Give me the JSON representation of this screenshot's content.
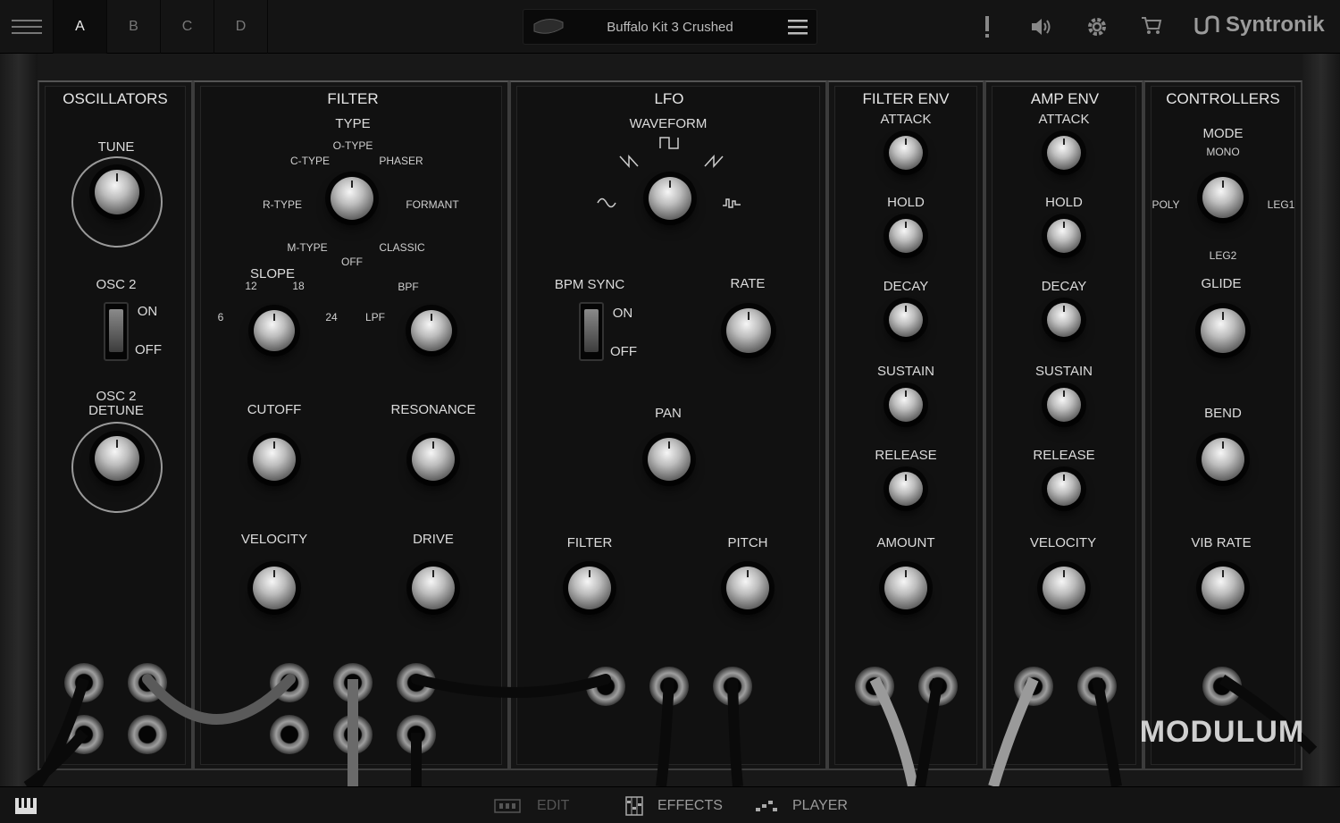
{
  "topbar": {
    "banks": [
      "A",
      "B",
      "C",
      "D"
    ],
    "active_bank": "A",
    "preset_name": "Buffalo Kit 3 Crushed",
    "brand": "Syntronik"
  },
  "oscillators": {
    "title": "OSCILLATORS",
    "tune_label": "TUNE",
    "osc2_label": "OSC 2",
    "on": "ON",
    "off": "OFF",
    "detune_label_1": "OSC 2",
    "detune_label_2": "DETUNE"
  },
  "filter": {
    "title": "FILTER",
    "type_label": "TYPE",
    "types": {
      "o": "O-TYPE",
      "c": "C-TYPE",
      "phaser": "PHASER",
      "r": "R-TYPE",
      "formant": "FORMANT",
      "m": "M-TYPE",
      "classic": "CLASSIC",
      "off": "OFF"
    },
    "slope_label": "SLOPE",
    "slopes": {
      "s6": "6",
      "s12": "12",
      "s18": "18",
      "s24": "24"
    },
    "mode": {
      "bpf": "BPF",
      "lpf": "LPF"
    },
    "cutoff": "CUTOFF",
    "resonance": "RESONANCE",
    "velocity": "VELOCITY",
    "drive": "DRIVE"
  },
  "lfo": {
    "title": "LFO",
    "waveform_label": "WAVEFORM",
    "bpm_sync": "BPM SYNC",
    "on": "ON",
    "off": "OFF",
    "rate": "RATE",
    "pan": "PAN",
    "filter": "FILTER",
    "pitch": "PITCH"
  },
  "filter_env": {
    "title": "FILTER ENV",
    "attack": "ATTACK",
    "hold": "HOLD",
    "decay": "DECAY",
    "sustain": "SUSTAIN",
    "release": "RELEASE",
    "amount": "AMOUNT"
  },
  "amp_env": {
    "title": "AMP ENV",
    "attack": "ATTACK",
    "hold": "HOLD",
    "decay": "DECAY",
    "sustain": "SUSTAIN",
    "release": "RELEASE",
    "velocity": "VELOCITY"
  },
  "controllers": {
    "title": "CONTROLLERS",
    "mode": "MODE",
    "mono": "MONO",
    "poly": "POLY",
    "leg1": "LEG1",
    "leg2": "LEG2",
    "glide": "GLIDE",
    "bend": "BEND",
    "vib_rate": "VIB RATE",
    "model": "MODULUM"
  },
  "bottombar": {
    "edit": "EDIT",
    "effects": "EFFECTS",
    "player": "PLAYER"
  },
  "icons": {
    "menu": "hamburger-icon",
    "alert": "exclamation-icon",
    "volume": "speaker-icon",
    "settings": "gear-icon",
    "cart": "cart-icon",
    "keyboard": "keyboard-icon"
  },
  "colors": {
    "accent": "#e6e6e6",
    "panel": "#111111",
    "muted": "#777777"
  }
}
